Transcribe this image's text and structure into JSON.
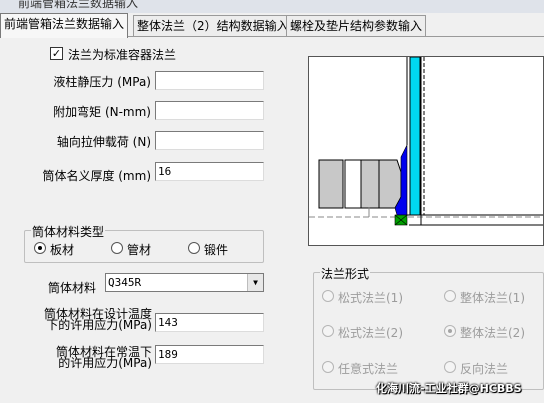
{
  "window": {
    "title": "前端管箱法兰数据输入"
  },
  "tabs": [
    {
      "label": "前端管箱法兰数据输入"
    },
    {
      "label": "整体法兰（2）结构数据输入"
    },
    {
      "label": "螺栓及垫片结构参数输入"
    }
  ],
  "standard_flange": {
    "label": "法兰为标准容器法兰",
    "checked": true,
    "mark": "✓"
  },
  "fields": {
    "static_pressure": {
      "label": "液柱静压力 (MPa)",
      "value": ""
    },
    "extra_moment": {
      "label": "附加弯矩 (N-mm)",
      "value": ""
    },
    "axial_load": {
      "label": "轴向拉伸载荷 (N)",
      "value": ""
    },
    "nominal_thickness": {
      "label": "筒体名义厚度 (mm)",
      "value": "16"
    }
  },
  "material_type": {
    "title": "筒体材料类型",
    "options": [
      {
        "label": "板材",
        "selected": true
      },
      {
        "label": "管材",
        "selected": false
      },
      {
        "label": "锻件",
        "selected": false
      }
    ]
  },
  "material": {
    "label": "筒体材料",
    "value": "Q345R",
    "arrow": "▼"
  },
  "allow_stress_design": {
    "label_line1": "筒体材料在设计温度",
    "label_line2": "下的许用应力(MPa)",
    "value": "143"
  },
  "allow_stress_room": {
    "label_line1": "筒体材料在常温下",
    "label_line2": "的许用应力(MPa)",
    "value": "189"
  },
  "flange_form": {
    "title": "法兰形式",
    "options": [
      {
        "label": "松式法兰(1)",
        "selected": false
      },
      {
        "label": "整体法兰(1)",
        "selected": false
      },
      {
        "label": "松式法兰(2)",
        "selected": false
      },
      {
        "label": "整体法兰(2)",
        "selected": true
      },
      {
        "label": "任意式法兰",
        "selected": false
      },
      {
        "label": "反向法兰",
        "selected": false
      }
    ]
  },
  "watermark": "化海川流-工业社群@HCBBS",
  "colors": {
    "shell_cyan": "#00d8f0",
    "weld_blue": "#0000ee",
    "flange_gray": "#c8c8c8",
    "gasket_green": "#00a000"
  }
}
